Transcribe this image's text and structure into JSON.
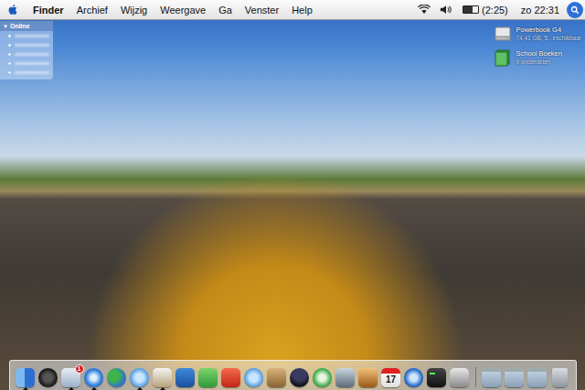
{
  "menu_bar": {
    "app": "Finder",
    "menus": [
      "Archief",
      "Wijzig",
      "Weergave",
      "Ga",
      "Venster",
      "Help"
    ],
    "battery": "(2:25)",
    "battery_level": 0.6,
    "clock": "zo 22:31"
  },
  "buddy_list": {
    "toggle": "▼",
    "title": "Online",
    "expanded": true,
    "items": [
      {
        "online": true
      },
      {
        "online": true
      },
      {
        "online": true
      },
      {
        "online": true
      },
      {
        "online": true
      }
    ]
  },
  "desktop_icons": [
    {
      "name": "Powerbook G4",
      "info": "74,41 GB, 5...eschikbaar",
      "kind": "disk"
    },
    {
      "name": "School Boeken",
      "info": "9 onderdelen",
      "kind": "folder"
    }
  ],
  "dock": {
    "items": [
      {
        "kind": "finder",
        "running": true
      },
      {
        "kind": "dashboard",
        "running": false
      },
      {
        "kind": "mail",
        "running": true,
        "badge": "1"
      },
      {
        "kind": "safari",
        "running": true
      },
      {
        "kind": "buddies",
        "running": false
      },
      {
        "kind": "ichat",
        "running": true
      },
      {
        "kind": "preview",
        "running": true
      },
      {
        "kind": "word",
        "running": false
      },
      {
        "kind": "green",
        "running": false
      },
      {
        "kind": "red",
        "running": false
      },
      {
        "kind": "ichat",
        "running": false
      },
      {
        "kind": "addressbook",
        "running": false
      },
      {
        "kind": "wizard",
        "running": false
      },
      {
        "kind": "itunes",
        "running": false
      },
      {
        "kind": "iphoto",
        "running": false
      },
      {
        "kind": "garageband",
        "running": false
      },
      {
        "kind": "ical",
        "running": false,
        "label": "17"
      },
      {
        "kind": "quicktime",
        "running": false
      },
      {
        "kind": "terminal",
        "running": false
      },
      {
        "kind": "prefs",
        "running": false
      },
      {
        "kind": "separator",
        "running": false
      },
      {
        "kind": "window",
        "running": false
      },
      {
        "kind": "window",
        "running": false
      },
      {
        "kind": "window",
        "running": false
      },
      {
        "kind": "trash",
        "running": false
      }
    ]
  }
}
